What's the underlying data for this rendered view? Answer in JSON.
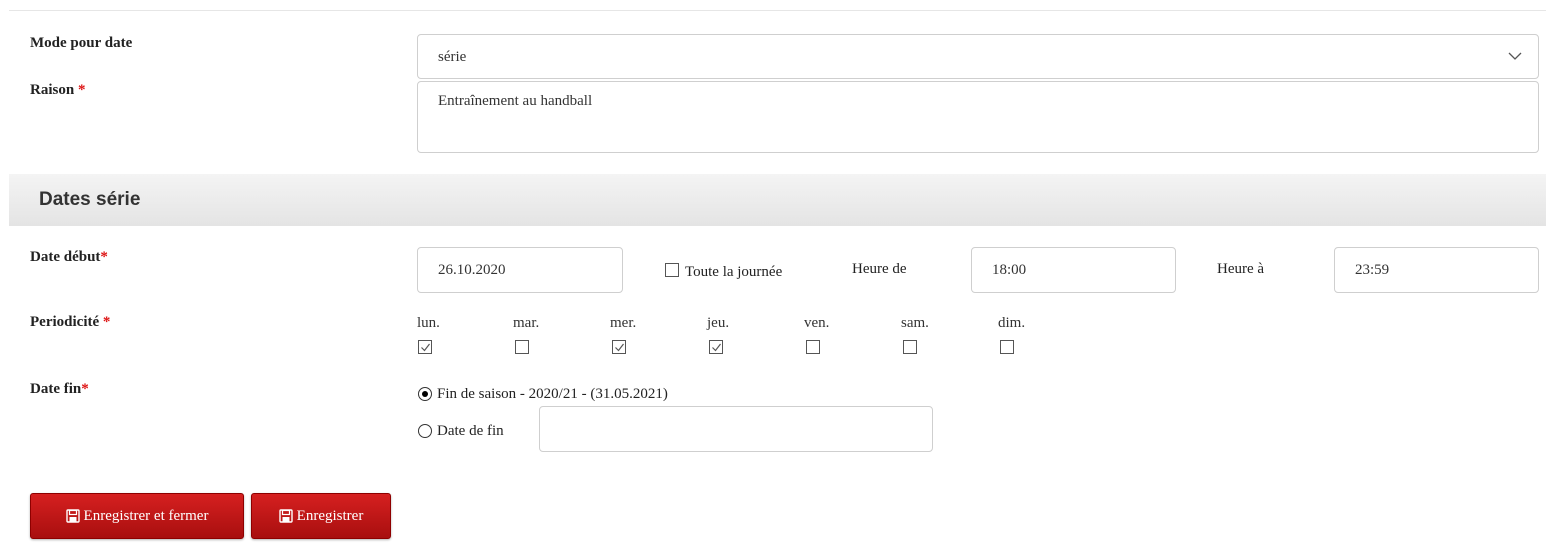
{
  "form": {
    "mode_label": "Mode pour date",
    "mode_value": "série",
    "reason_label": "Raison",
    "reason_required": "*",
    "reason_value": "Entraînement au handball"
  },
  "section": {
    "title": "Dates série"
  },
  "dates": {
    "start_label": "Date début",
    "start_required": "*",
    "start_value": "26.10.2020",
    "all_day_label": "Toute la journée",
    "all_day_checked": false,
    "time_from_label": "Heure de",
    "time_from_value": "18:00",
    "time_to_label": "Heure à",
    "time_to_value": "23:59",
    "periodicity_label": "Periodicité",
    "periodicity_required": "*",
    "days": [
      {
        "label": "lun.",
        "checked": true
      },
      {
        "label": "mar.",
        "checked": false
      },
      {
        "label": "mer.",
        "checked": true
      },
      {
        "label": "jeu.",
        "checked": true
      },
      {
        "label": "ven.",
        "checked": false
      },
      {
        "label": "sam.",
        "checked": false
      },
      {
        "label": "dim.",
        "checked": false
      }
    ],
    "end_label": "Date fin",
    "end_required": "*",
    "end_option_season": "Fin de saison - 2020/21 - (31.05.2021)",
    "end_option_date": "Date de fin",
    "end_selected": "season",
    "end_date_value": ""
  },
  "buttons": {
    "save_close": "Enregistrer et fermer",
    "save": "Enregistrer"
  },
  "icons": {
    "select_chevron": "chevron-down-icon",
    "save": "floppy-disk-icon",
    "checkbox_check": "check-icon"
  },
  "colors": {
    "required": "#dd1111",
    "button_bg": "#c41a1a",
    "section_bg": "#ececec"
  }
}
